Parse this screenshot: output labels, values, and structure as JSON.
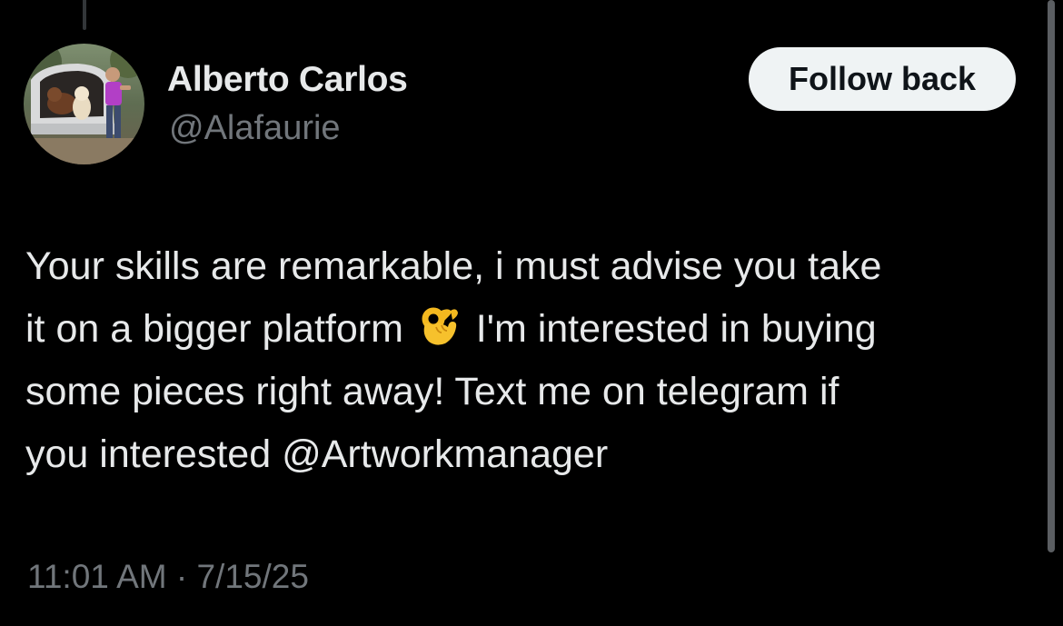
{
  "author": {
    "display_name": "Alberto Carlos",
    "handle": "@Alafaurie",
    "avatar_icon": "profile-photo"
  },
  "actions": {
    "follow_label": "Follow back"
  },
  "tweet": {
    "line1": "Your skills are remarkable, i must advise you take",
    "line2_before": "it on a bigger platform",
    "emoji": "ok-hand-emoji",
    "line2_after": "I'm interested in buying",
    "line3": "some pieces right away! Text me on telegram if",
    "line4_before": "you interested ",
    "mention": "@Artworkmanager"
  },
  "meta": {
    "time": "11:01 AM",
    "separator": " · ",
    "date": "7/15/25"
  },
  "colors": {
    "background": "#000000",
    "text_primary": "#e7e9ea",
    "text_secondary": "#71767b",
    "button_bg": "#eff3f4",
    "button_text": "#0f1419"
  }
}
